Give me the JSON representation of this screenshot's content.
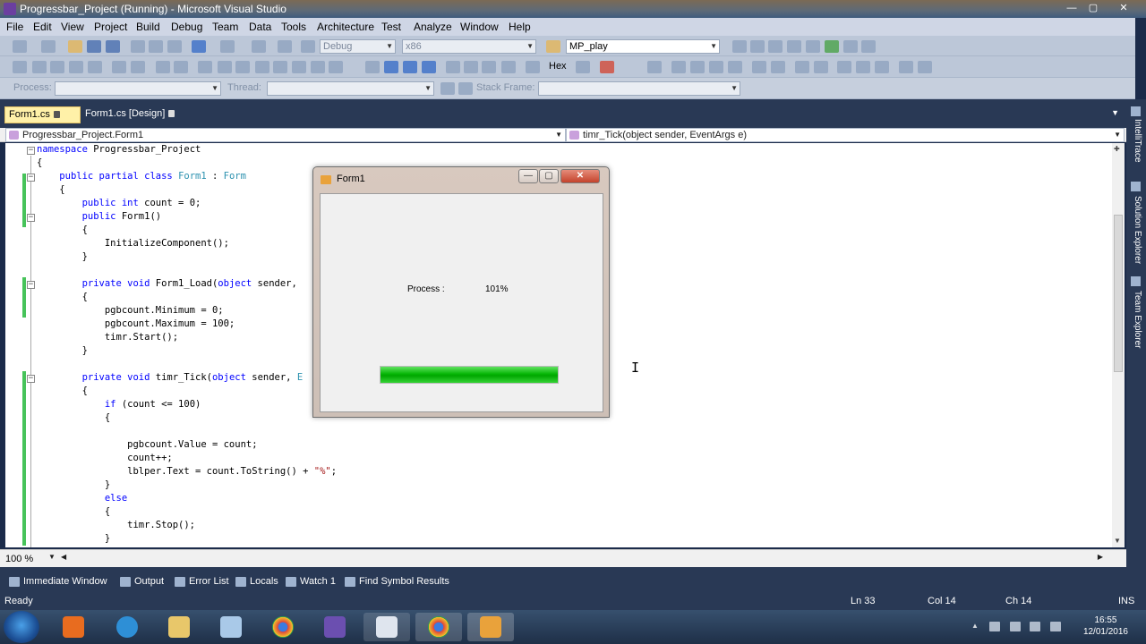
{
  "window": {
    "title": "Progressbar_Project (Running) - Microsoft Visual Studio",
    "minimize": "—",
    "maximize": "▢",
    "close": "✕"
  },
  "menu": [
    "File",
    "Edit",
    "View",
    "Project",
    "Build",
    "Debug",
    "Team",
    "Data",
    "Tools",
    "Architecture",
    "Test",
    "Analyze",
    "Window",
    "Help"
  ],
  "toolbar": {
    "config": "Debug",
    "platform": "x86",
    "startup_item": "MP_play",
    "hex_label": "Hex",
    "process_label": "Process:",
    "thread_label": "Thread:",
    "stack_frame_label": "Stack Frame:"
  },
  "doc_tabs": [
    {
      "label": "Form1.cs",
      "active": true
    },
    {
      "label": "Form1.cs [Design]",
      "active": false
    }
  ],
  "nav": {
    "type_combo": "Progressbar_Project.Form1",
    "member_combo": "timr_Tick(object sender, EventArgs e)"
  },
  "code": [
    {
      "t": [
        [
          "kw",
          "namespace"
        ],
        [
          "",
          " Progressbar_Project"
        ]
      ]
    },
    {
      "t": [
        [
          "",
          "{"
        ]
      ]
    },
    {
      "t": [
        [
          "",
          "    "
        ],
        [
          "kw",
          "public partial class"
        ],
        [
          "",
          " "
        ],
        [
          "ty",
          "Form1"
        ],
        [
          "",
          " : "
        ],
        [
          "ty",
          "Form"
        ]
      ]
    },
    {
      "t": [
        [
          "",
          "    {"
        ]
      ]
    },
    {
      "t": [
        [
          "",
          "        "
        ],
        [
          "kw",
          "public int"
        ],
        [
          "",
          " count = 0;"
        ]
      ]
    },
    {
      "t": [
        [
          "",
          "        "
        ],
        [
          "kw",
          "public"
        ],
        [
          "",
          " Form1()"
        ]
      ]
    },
    {
      "t": [
        [
          "",
          "        {"
        ]
      ]
    },
    {
      "t": [
        [
          "",
          "            InitializeComponent();"
        ]
      ]
    },
    {
      "t": [
        [
          "",
          "        }"
        ]
      ]
    },
    {
      "t": [
        [
          "",
          ""
        ]
      ]
    },
    {
      "t": [
        [
          "",
          "        "
        ],
        [
          "kw",
          "private void"
        ],
        [
          "",
          " Form1_Load("
        ],
        [
          "kw",
          "object"
        ],
        [
          "",
          " sender,"
        ]
      ]
    },
    {
      "t": [
        [
          "",
          "        {"
        ]
      ]
    },
    {
      "t": [
        [
          "",
          "            pgbcount.Minimum = 0;"
        ]
      ]
    },
    {
      "t": [
        [
          "",
          "            pgbcount.Maximum = 100;"
        ]
      ]
    },
    {
      "t": [
        [
          "",
          "            timr.Start();"
        ]
      ]
    },
    {
      "t": [
        [
          "",
          "        }"
        ]
      ]
    },
    {
      "t": [
        [
          "",
          ""
        ]
      ]
    },
    {
      "t": [
        [
          "",
          "        "
        ],
        [
          "kw",
          "private void"
        ],
        [
          "",
          " timr_Tick("
        ],
        [
          "kw",
          "object"
        ],
        [
          "",
          " sender, "
        ],
        [
          "ty",
          "E"
        ]
      ]
    },
    {
      "t": [
        [
          "",
          "        {"
        ]
      ]
    },
    {
      "t": [
        [
          "",
          "            "
        ],
        [
          "kw",
          "if"
        ],
        [
          "",
          " (count <= 100)"
        ]
      ]
    },
    {
      "t": [
        [
          "",
          "            {"
        ]
      ]
    },
    {
      "t": [
        [
          "",
          ""
        ]
      ]
    },
    {
      "t": [
        [
          "",
          "                pgbcount.Value = count;"
        ]
      ]
    },
    {
      "t": [
        [
          "",
          "                count++;"
        ]
      ]
    },
    {
      "t": [
        [
          "",
          "                lblper.Text = count.ToString() + "
        ],
        [
          "str",
          "\"%\""
        ],
        [
          "",
          ";"
        ]
      ]
    },
    {
      "t": [
        [
          "",
          "            }"
        ]
      ]
    },
    {
      "t": [
        [
          "",
          "            "
        ],
        [
          "kw",
          "else"
        ]
      ]
    },
    {
      "t": [
        [
          "",
          "            {"
        ]
      ]
    },
    {
      "t": [
        [
          "",
          "                timr.Stop();"
        ]
      ]
    },
    {
      "t": [
        [
          "",
          "            }"
        ]
      ]
    },
    {
      "t": [
        [
          "",
          "        }"
        ]
      ]
    }
  ],
  "editor": {
    "zoom": "100 %"
  },
  "form1": {
    "title": "Form1",
    "process_label": "Process :",
    "percent_label": "101%",
    "progress": 1.0,
    "minimize": "—",
    "maximize": "▢",
    "close": "✕"
  },
  "right_dock": [
    "IntelliTrace",
    "Solution Explorer",
    "Team Explorer"
  ],
  "tool_windows": [
    "Immediate Window",
    "Output",
    "Error List",
    "Locals",
    "Watch 1",
    "Find Symbol Results"
  ],
  "status": {
    "ready": "Ready",
    "ln": "Ln 33",
    "col": "Col 14",
    "ch": "Ch 14",
    "ins": "INS"
  },
  "tray": {
    "time": "16:55",
    "date": "12/01/2016"
  },
  "colors": {
    "accent_dark": "#293955",
    "progress_green": "#06b706",
    "active_tab": "#fff1a8"
  }
}
